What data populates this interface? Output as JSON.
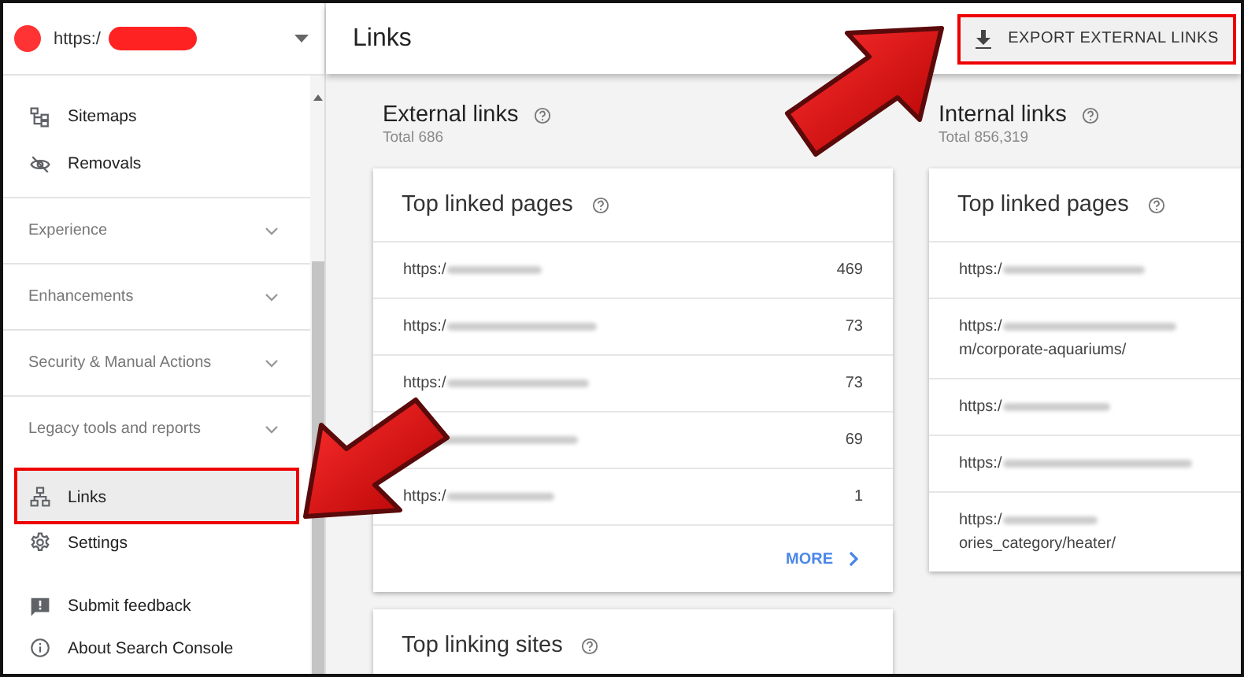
{
  "property": {
    "url": "https:/"
  },
  "nav": [
    {
      "kind": "item",
      "label": "Sitemaps",
      "selected": false,
      "annotated": false
    },
    {
      "kind": "item",
      "label": "Removals",
      "selected": false,
      "annotated": false
    },
    {
      "kind": "section",
      "label": "Experience",
      "expanded": false
    },
    {
      "kind": "section",
      "label": "Enhancements",
      "expanded": false
    },
    {
      "kind": "section",
      "label": "Security & Manual Actions",
      "expanded": false
    },
    {
      "kind": "section",
      "label": "Legacy tools and reports",
      "expanded": false
    },
    {
      "kind": "item",
      "label": "Links",
      "selected": true,
      "annotated": true
    },
    {
      "kind": "item",
      "label": "Settings",
      "selected": false,
      "annotated": false
    },
    {
      "kind": "item",
      "label": "Submit feedback",
      "selected": false,
      "annotated": false
    },
    {
      "kind": "item",
      "label": "About Search Console",
      "selected": false,
      "annotated": false
    }
  ],
  "header": {
    "title": "Links",
    "export_button": {
      "label": "EXPORT EXTERNAL LINKS",
      "annotated": true
    }
  },
  "columns": [
    {
      "title": "External links",
      "total": "Total 686",
      "cards": [
        {
          "title": "Top linked pages",
          "rows": [
            {
              "url": "https:/",
              "count": "469"
            },
            {
              "url": "https:/",
              "count": "73"
            },
            {
              "url": "https:/",
              "count": "73"
            },
            {
              "count": "69"
            },
            {
              "url": "https:/",
              "count": "1"
            }
          ],
          "more": "MORE"
        },
        {
          "title": "Top linking sites"
        }
      ]
    },
    {
      "title": "Internal links",
      "total": "Total 856,319",
      "cards": [
        {
          "title": "Top linked pages",
          "rows": [
            {
              "url": "https:/"
            },
            {
              "url": "https:/",
              "continuation": "m/corporate-aquariums/"
            },
            {
              "url": "https:/"
            },
            {
              "url": "https:/"
            },
            {
              "url": "https:/",
              "continuation": "ories_category/heater/"
            }
          ]
        }
      ]
    }
  ]
}
